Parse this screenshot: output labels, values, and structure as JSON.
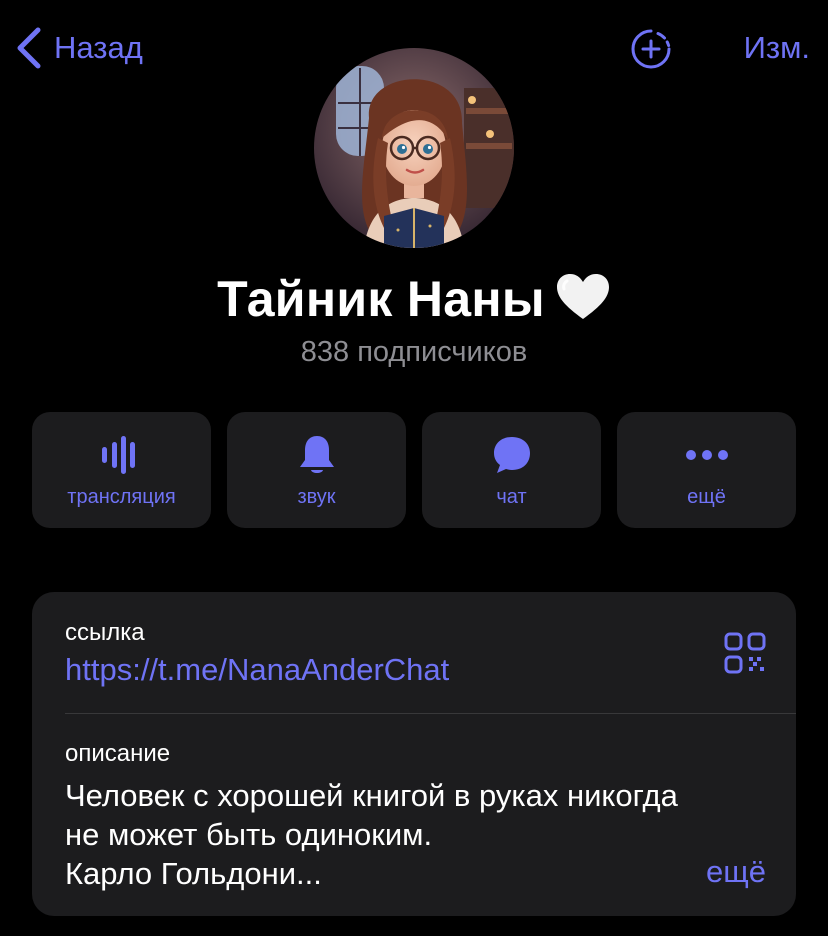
{
  "header": {
    "back_label": "Назад",
    "edit_label": "Изм."
  },
  "channel": {
    "name": "Тайник Наны",
    "emoji": "white-heart-icon",
    "subscribers": "838 подписчиков"
  },
  "actions": [
    {
      "label": "трансляция",
      "icon": "livestream-icon"
    },
    {
      "label": "звук",
      "icon": "bell-icon"
    },
    {
      "label": "чат",
      "icon": "chat-bubble-icon"
    },
    {
      "label": "ещё",
      "icon": "more-dots-icon"
    }
  ],
  "info": {
    "link_caption": "ссылка",
    "link_value": "https://t.me/NanaAnderChat",
    "description_caption": "описание",
    "description_lines": [
      "Человек с хорошей книгой в руках никогда",
      "не может быть одиноким.",
      "Карло Гольдони..."
    ],
    "more_label": "ещё"
  },
  "colors": {
    "accent": "#6f73f5",
    "background": "#000000",
    "card": "#1c1c1e",
    "secondary_text": "#8e8e93"
  }
}
